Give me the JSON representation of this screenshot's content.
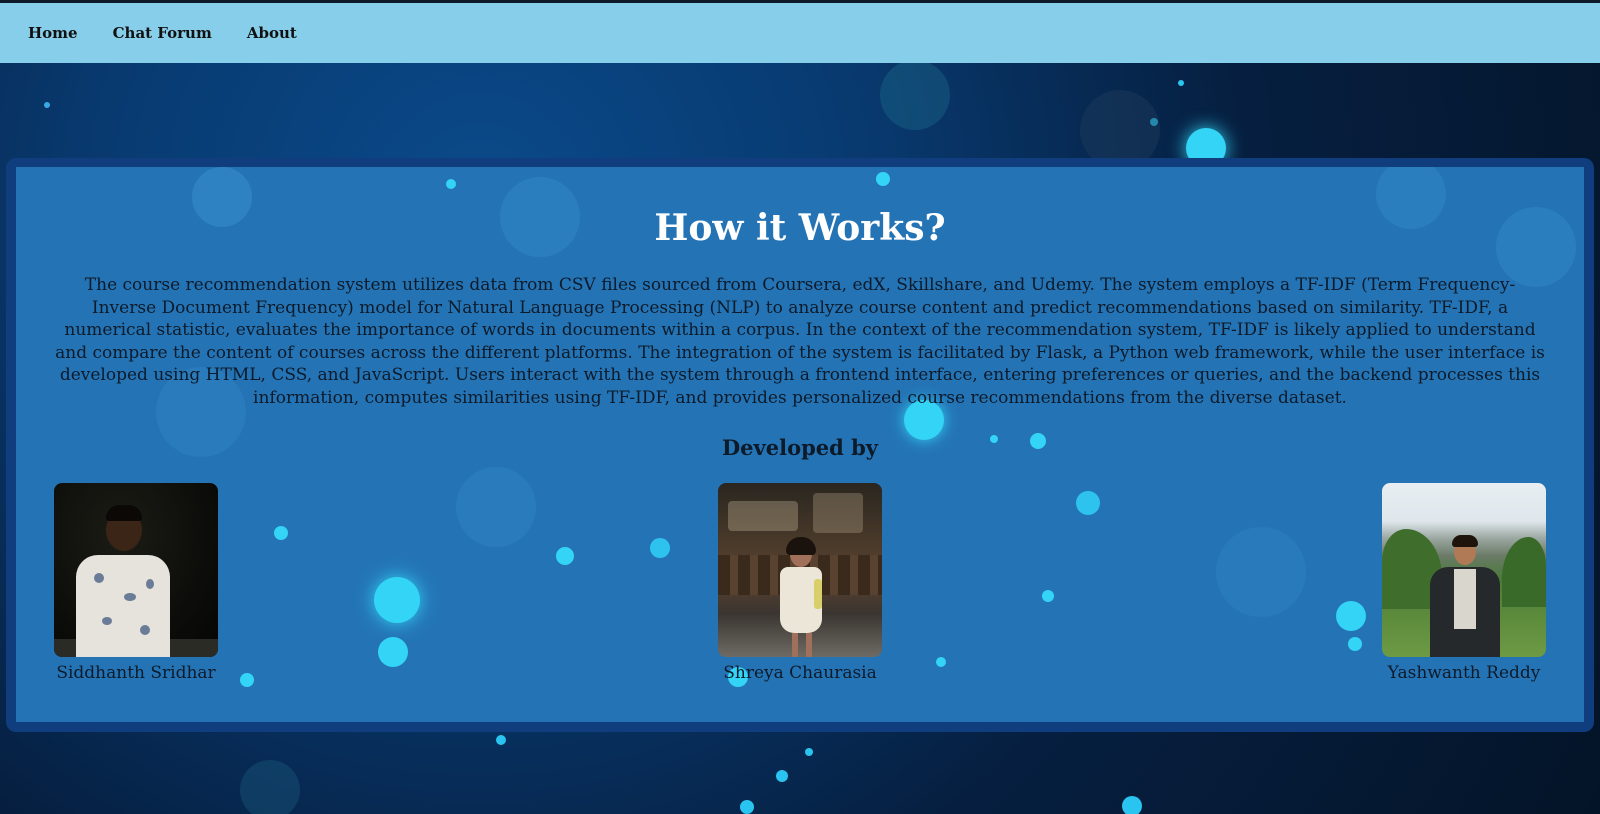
{
  "nav": {
    "home": "Home",
    "chat_forum": "Chat Forum",
    "about": "About"
  },
  "main": {
    "title": "How it Works?",
    "description": "The course recommendation system utilizes data from CSV files sourced from Coursera, edX, Skillshare, and Udemy. The system employs a TF-IDF (Term Frequency-Inverse Document Frequency) model for Natural Language Processing (NLP) to analyze course content and predict recommendations based on similarity. TF-IDF, a numerical statistic, evaluates the importance of words in documents within a corpus. In the context of the recommendation system, TF-IDF is likely applied to understand and compare the content of courses across the different platforms. The integration of the system is facilitated by Flask, a Python web framework, while the user interface is developed using HTML, CSS, and JavaScript. Users interact with the system through a frontend interface, entering preferences or queries, and the backend processes this information, computes similarities using TF-IDF, and provides personalized course recommendations from the diverse dataset.",
    "developed_by": "Developed by",
    "developers": [
      {
        "name": "Siddhanth Sridhar"
      },
      {
        "name": "Shreya Chaurasia"
      },
      {
        "name": "Yashwanth Reddy"
      }
    ]
  },
  "colors": {
    "navbar": "#87ceeb",
    "panel": "#2678ba",
    "panel_border": "#0f3d7e",
    "title_text": "#ffffff",
    "body_text": "#0d1a2a"
  }
}
